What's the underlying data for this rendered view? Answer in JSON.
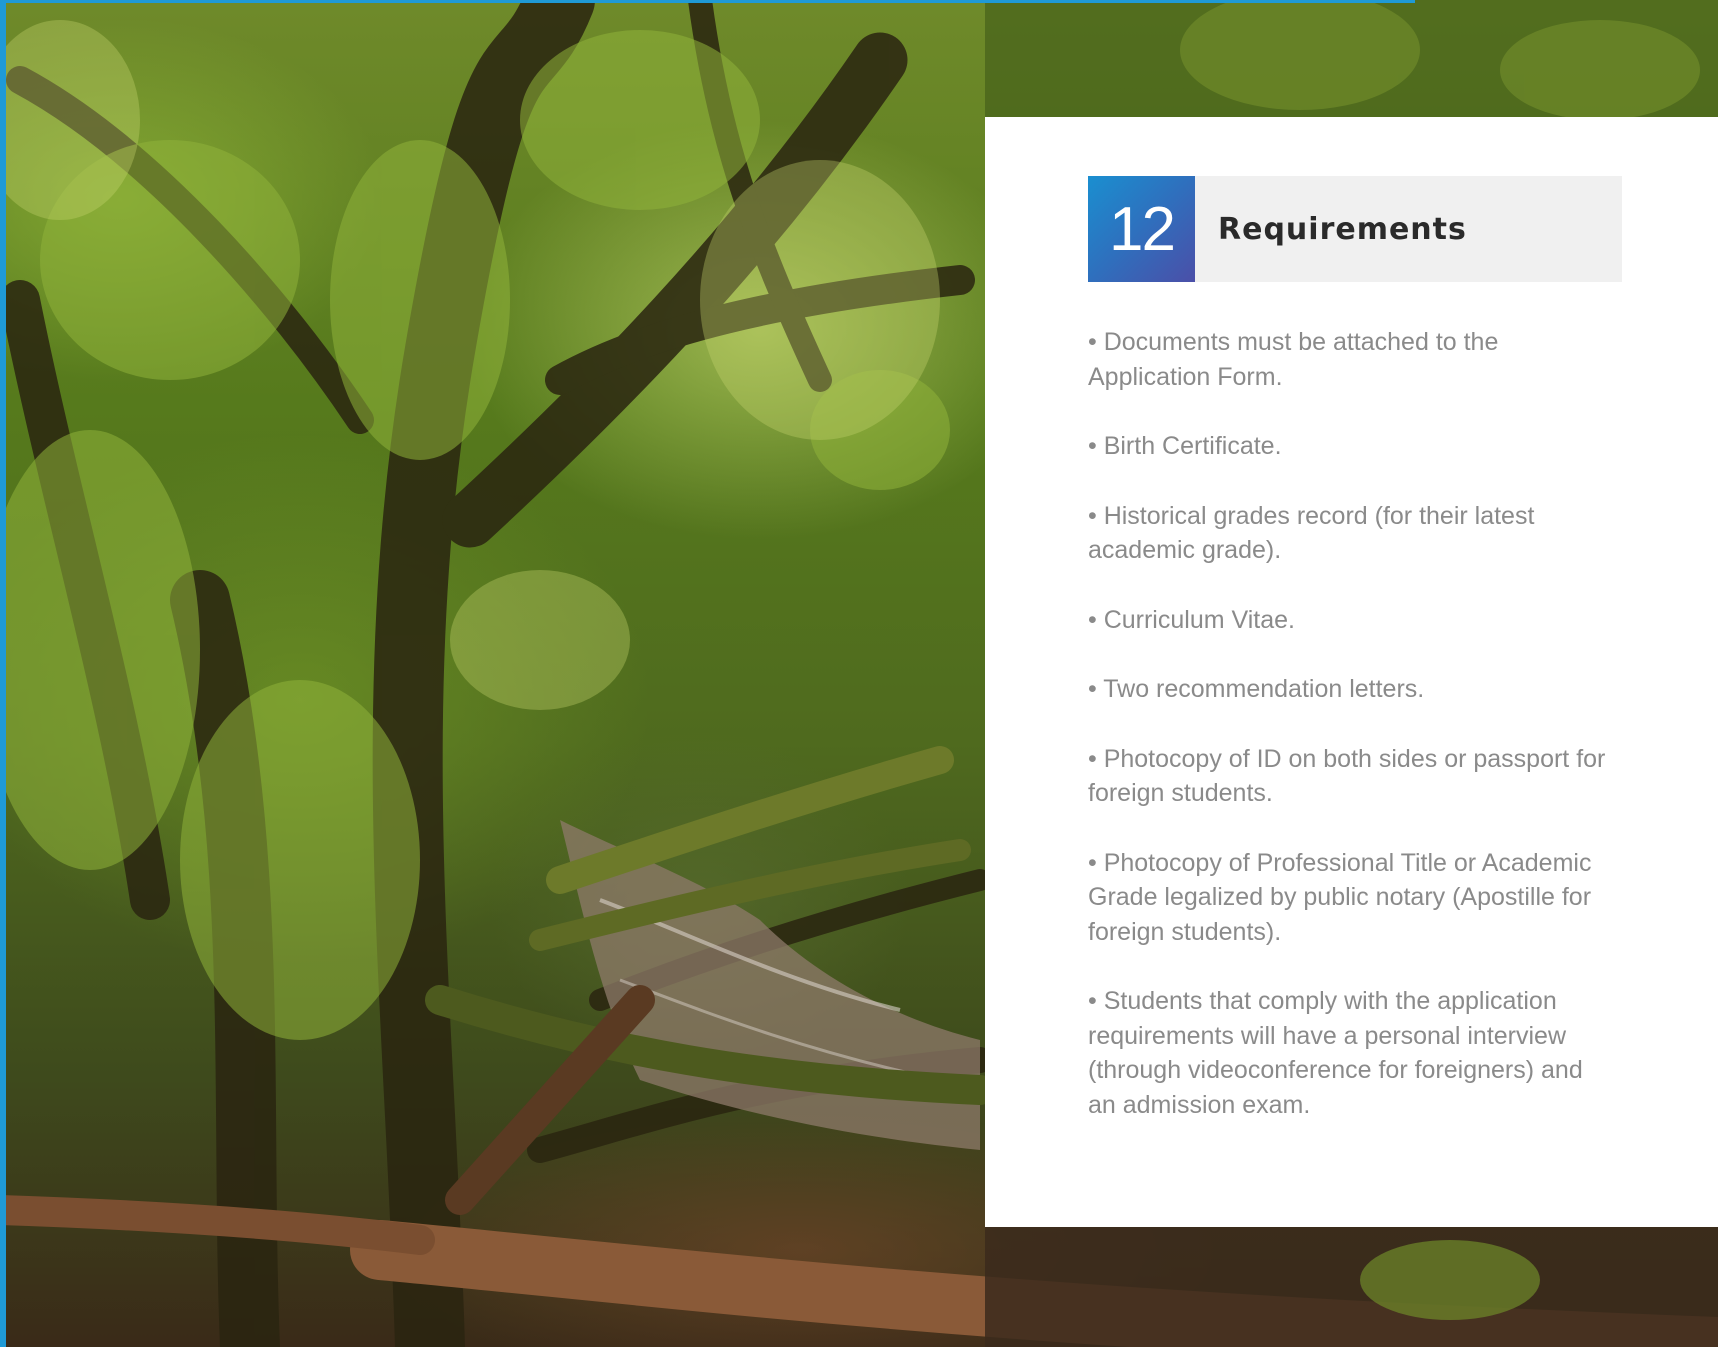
{
  "section": {
    "number": "12",
    "title": "Requirements"
  },
  "requirements": [
    "• Documents must be attached to the Application Form.",
    "• Birth Certificate.",
    "• Historical grades record (for their latest academic grade).",
    "• Curriculum Vitae.",
    "• Two recommendation letters.",
    "• Photocopy of ID on both sides or passport for foreign students.",
    "• Photocopy of Professional Title or Academic Grade legalized by public notary (Apostille for foreign students).",
    "• Students that comply with the application requirements will have a personal interview (through videoconference for foreigners) and an admission exam."
  ],
  "colors": {
    "accent_blue": "#1a8fd0",
    "accent_purple": "#4b4fa8",
    "body_text": "#8a8a8a",
    "header_bg": "#f0f0f0"
  },
  "icons": {
    "background_image": "forest-stream-photo"
  }
}
